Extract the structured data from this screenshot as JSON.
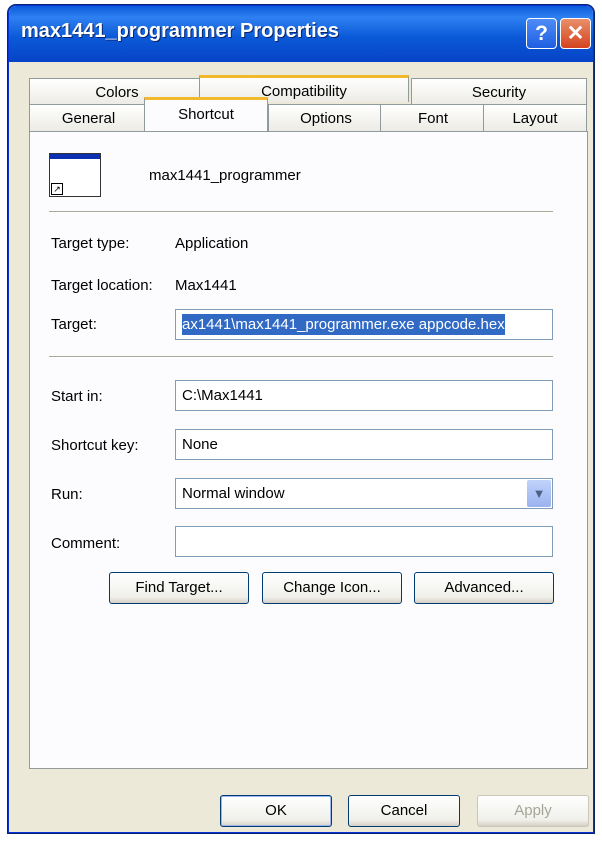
{
  "window": {
    "title": "max1441_programmer Properties"
  },
  "tabs": {
    "row_back": [
      "Colors",
      "Compatibility",
      "Security"
    ],
    "row_front": [
      "General",
      "Shortcut",
      "Options",
      "Font",
      "Layout"
    ],
    "selected": "Shortcut"
  },
  "shortcut": {
    "name": "max1441_programmer",
    "target_type_label": "Target type:",
    "target_type_value": "Application",
    "target_location_label": "Target location:",
    "target_location_value": "Max1441",
    "target_label": "Target:",
    "target_value": "ax1441\\max1441_programmer.exe appcode.hex",
    "start_in_label": "Start in:",
    "start_in_value": "C:\\Max1441",
    "shortcut_key_label": "Shortcut key:",
    "shortcut_key_value": "None",
    "run_label": "Run:",
    "run_value": "Normal window",
    "comment_label": "Comment:",
    "comment_value": "",
    "find_target_label": "Find Target...",
    "change_icon_label": "Change Icon...",
    "advanced_label": "Advanced..."
  },
  "footer": {
    "ok_label": "OK",
    "cancel_label": "Cancel",
    "apply_label": "Apply"
  }
}
